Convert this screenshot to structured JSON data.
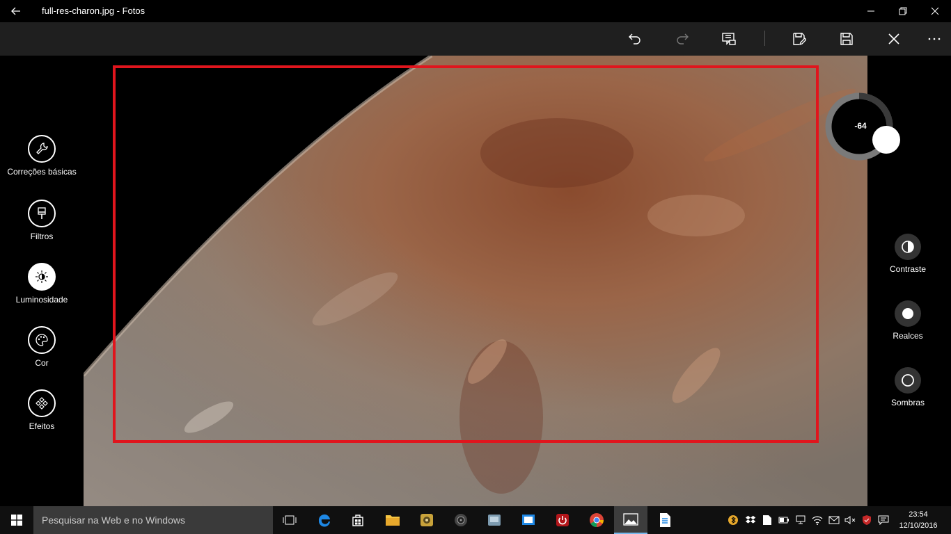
{
  "window": {
    "title": "full-res-charon.jpg - Fotos"
  },
  "left_rail": {
    "items": [
      {
        "label": "Correções básicas",
        "icon": "wrench-icon"
      },
      {
        "label": "Filtros",
        "icon": "brush-icon"
      },
      {
        "label": "Luminosidade",
        "icon": "brightness-icon",
        "active": true
      },
      {
        "label": "Cor",
        "icon": "palette-icon"
      },
      {
        "label": "Efeitos",
        "icon": "effects-icon"
      }
    ]
  },
  "dial": {
    "value": "-64"
  },
  "right_rail": {
    "items": [
      {
        "label": "Contraste",
        "icon": "contrast-icon"
      },
      {
        "label": "Realces",
        "icon": "highlights-icon"
      },
      {
        "label": "Sombras",
        "icon": "shadows-icon"
      }
    ]
  },
  "taskbar": {
    "search_placeholder": "Pesquisar na Web e no Windows",
    "time": "23:54",
    "date": "12/10/2016"
  },
  "colors": {
    "crop_frame": "#e0151d",
    "toolbar_bg": "#1f1f1f",
    "taskbar_accent": "#76b9ed"
  }
}
